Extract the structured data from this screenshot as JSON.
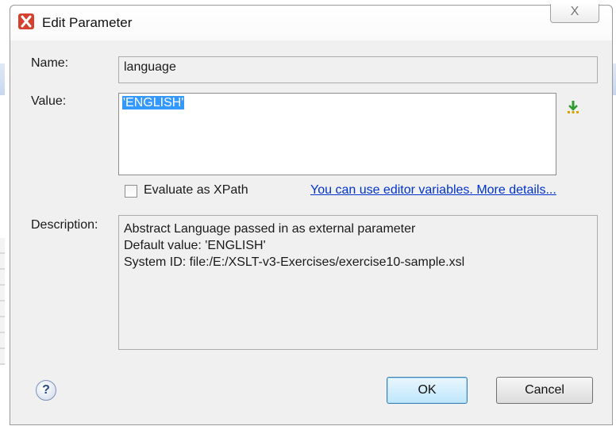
{
  "window": {
    "title": "Edit Parameter",
    "close_glyph": "X"
  },
  "form": {
    "name_label": "Name:",
    "name_value": "language",
    "value_label": "Value:",
    "value_text": "'ENGLISH'",
    "evaluate_label": "Evaluate as XPath",
    "evaluate_checked": false,
    "variables_link": "You can use editor variables. More details...",
    "description_label": "Description:",
    "description_lines": [
      "Abstract Language passed in as external parameter",
      "Default value: 'ENGLISH'",
      "System ID: file:/E:/XSLT-v3-Exercises/exercise10-sample.xsl"
    ]
  },
  "footer": {
    "help_glyph": "?",
    "ok_label": "OK",
    "cancel_label": "Cancel"
  },
  "icons": {
    "app": "xslt-app-icon",
    "insert_variable": "insert-variable-icon",
    "help": "help-icon"
  },
  "colors": {
    "selection": "#3399ff",
    "link": "#0033cc",
    "app_icon": "#d4412f"
  }
}
